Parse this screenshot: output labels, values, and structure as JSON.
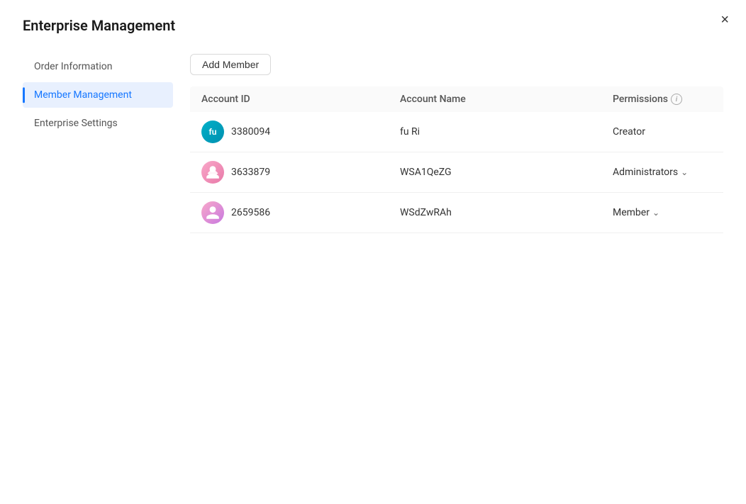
{
  "dialog": {
    "title": "Enterprise Management",
    "close_label": "×"
  },
  "sidebar": {
    "items": [
      {
        "id": "order-information",
        "label": "Order Information",
        "active": false
      },
      {
        "id": "member-management",
        "label": "Member Management",
        "active": true
      },
      {
        "id": "enterprise-settings",
        "label": "Enterprise Settings",
        "active": false
      }
    ]
  },
  "toolbar": {
    "add_member_label": "Add Member"
  },
  "table": {
    "headers": [
      {
        "id": "account-id",
        "label": "Account ID",
        "has_info": false
      },
      {
        "id": "account-name",
        "label": "Account Name",
        "has_info": false
      },
      {
        "id": "permissions",
        "label": "Permissions",
        "has_info": true
      }
    ],
    "rows": [
      {
        "id": "3380094",
        "avatar_type": "text",
        "avatar_initials": "fu",
        "avatar_style": "fu",
        "name": "fu Ri",
        "permission": "Creator",
        "has_dropdown": false
      },
      {
        "id": "3633879",
        "avatar_type": "icon",
        "avatar_style": "img1",
        "name": "WSA1QeZG",
        "permission": "Administrators",
        "has_dropdown": true
      },
      {
        "id": "2659586",
        "avatar_type": "icon",
        "avatar_style": "img2",
        "name": "WSdZwRAh",
        "permission": "Member",
        "has_dropdown": true
      }
    ]
  }
}
